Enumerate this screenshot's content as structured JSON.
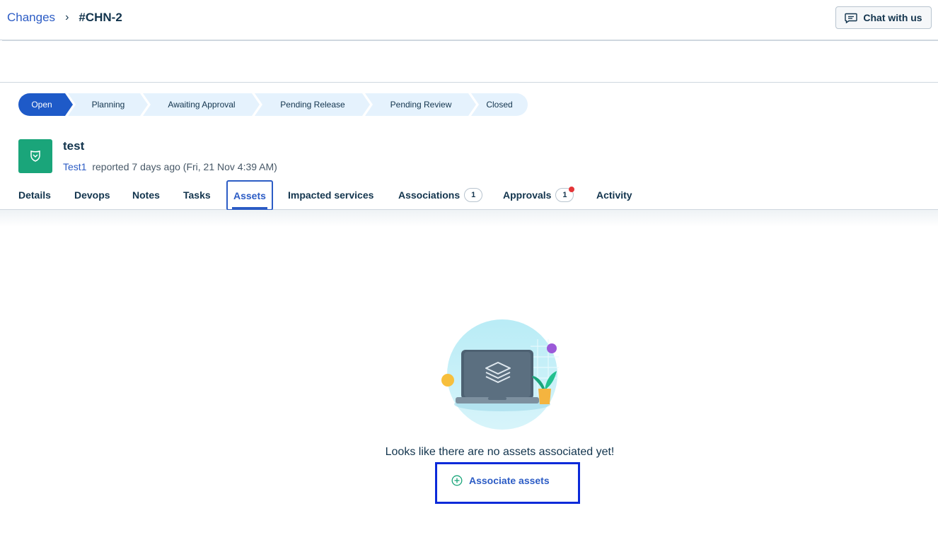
{
  "breadcrumb": {
    "parent": "Changes",
    "separator": "›",
    "current": "#CHN-2"
  },
  "header": {
    "chat_label": "Chat with us",
    "chat_icon": "chat-icon"
  },
  "stages": [
    "Open",
    "Planning",
    "Awaiting Approval",
    "Pending Release",
    "Pending Review",
    "Closed"
  ],
  "active_stage": "Open",
  "ticket": {
    "title": "test",
    "reporter": "Test1",
    "reported_text": "reported 7 days ago (Fri, 21 Nov 4:39 AM)",
    "icon": "shield-icon"
  },
  "tabs": {
    "details": "Details",
    "devops": "Devops",
    "notes": "Notes",
    "tasks": "Tasks",
    "assets": "Assets",
    "impacted": "Impacted services",
    "associations": "Associations",
    "associations_count": "1",
    "approvals": "Approvals",
    "approvals_count": "1",
    "activity": "Activity"
  },
  "active_tab": "Assets",
  "empty_state": {
    "message": "Looks like there are no assets associated yet!",
    "action_label": "Associate assets",
    "action_icon": "plus-circle-icon"
  },
  "colors": {
    "accent": "#2c5cc5",
    "active_stage": "#1e5ac8",
    "stage_bg": "#e5f2fd",
    "ticket_icon_bg": "#1aa57a",
    "highlight_box": "#0b2ad9"
  }
}
